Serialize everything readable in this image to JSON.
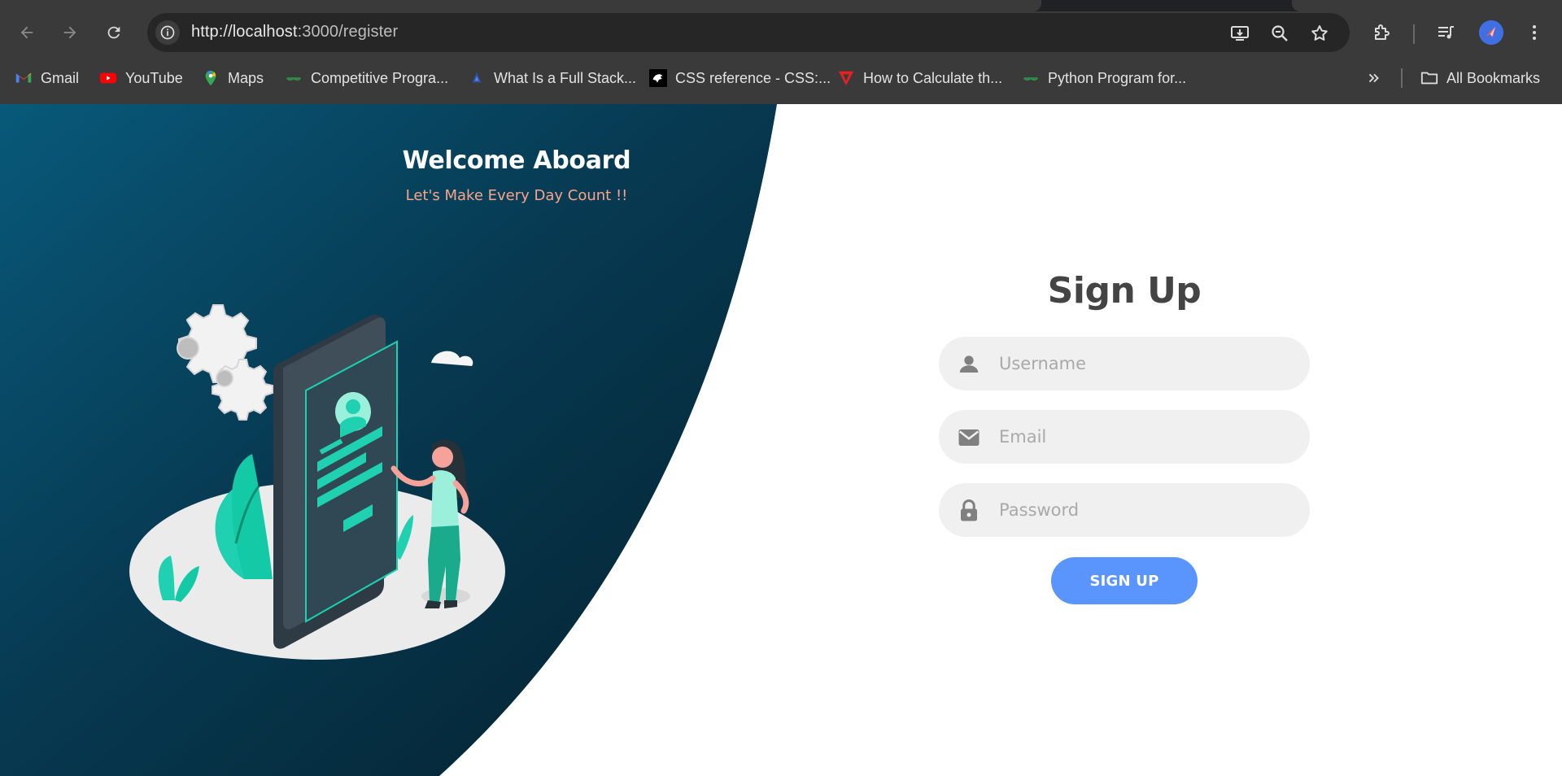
{
  "browser": {
    "url_host": "http://localhost",
    "url_rest": ":3000/register",
    "bookmarks": [
      {
        "label": "Gmail",
        "icon": "gmail-icon"
      },
      {
        "label": "YouTube",
        "icon": "youtube-icon"
      },
      {
        "label": "Maps",
        "icon": "maps-icon"
      },
      {
        "label": "Competitive Progra...",
        "icon": "geeksforgeeks-icon"
      },
      {
        "label": "What Is a Full Stack...",
        "icon": "site-icon"
      },
      {
        "label": "CSS reference - CSS:...",
        "icon": "mdn-icon"
      },
      {
        "label": "How to Calculate th...",
        "icon": "site-icon"
      },
      {
        "label": "Python Program for...",
        "icon": "geeksforgeeks-icon"
      }
    ],
    "all_bookmarks_label": "All Bookmarks"
  },
  "hero": {
    "title": "Welcome Aboard",
    "tagline": "Let's Make Every Day Count !!"
  },
  "form": {
    "title": "Sign Up",
    "username_placeholder": "Username",
    "email_placeholder": "Email",
    "password_placeholder": "Password",
    "submit_label": "SIGN UP"
  },
  "colors": {
    "accent": "#5995fd",
    "panel_dark": "#0b3a54",
    "tagline": "#f7a58a"
  }
}
